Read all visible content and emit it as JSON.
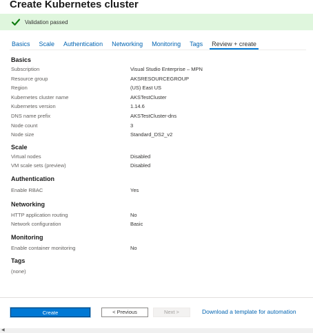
{
  "header": {
    "title": "Create Kubernetes cluster"
  },
  "banner": {
    "text": "Validation passed",
    "icon": "checkmark-icon",
    "color": "#dff6dd"
  },
  "tabs": [
    {
      "label": "Basics"
    },
    {
      "label": "Scale"
    },
    {
      "label": "Authentication"
    },
    {
      "label": "Networking"
    },
    {
      "label": "Monitoring"
    },
    {
      "label": "Tags"
    },
    {
      "label": "Review + create"
    }
  ],
  "sections": {
    "basics": {
      "title": "Basics",
      "rows": [
        {
          "label": "Subscription",
          "value": "Visual Studio Enterprise – MPN"
        },
        {
          "label": "Resource group",
          "value": "AKSRESOURCEGROUP"
        },
        {
          "label": "Region",
          "value": "(US) East US"
        },
        {
          "label": "Kubernetes cluster name",
          "value": "AKSTestCluster"
        },
        {
          "label": "Kubernetes version",
          "value": "1.14.6"
        },
        {
          "label": "DNS name prefix",
          "value": "AKSTestCluster-dns"
        },
        {
          "label": "Node count",
          "value": "3"
        },
        {
          "label": "Node size",
          "value": "Standard_DS2_v2"
        }
      ]
    },
    "scale": {
      "title": "Scale",
      "rows": [
        {
          "label": "Virtual nodes",
          "value": "Disabled"
        },
        {
          "label": "VM scale sets (preview)",
          "value": "Disabled"
        }
      ]
    },
    "authentication": {
      "title": "Authentication",
      "rows": [
        {
          "label": "Enable RBAC",
          "value": "Yes"
        }
      ]
    },
    "networking": {
      "title": "Networking",
      "rows": [
        {
          "label": "HTTP application routing",
          "value": "No"
        },
        {
          "label": "Network configuration",
          "value": "Basic"
        }
      ]
    },
    "monitoring": {
      "title": "Monitoring",
      "rows": [
        {
          "label": "Enable container monitoring",
          "value": "No"
        }
      ]
    },
    "tags": {
      "title": "Tags",
      "rows": [
        {
          "label": "(none)",
          "value": ""
        }
      ]
    }
  },
  "footer": {
    "create_label": "Create",
    "previous_label": "< Previous",
    "next_label": "Next >",
    "download_label": "Download a template for automation"
  }
}
